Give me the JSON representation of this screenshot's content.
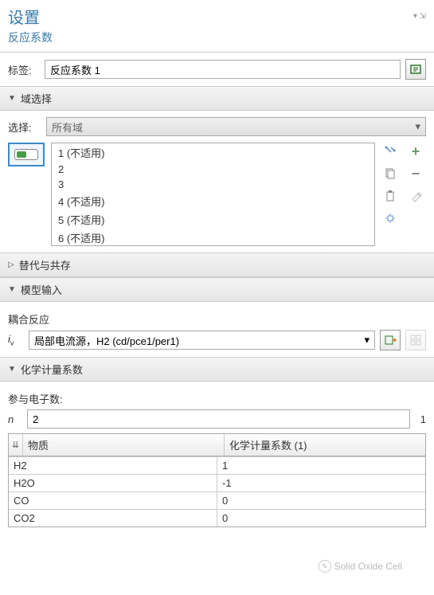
{
  "header": {
    "title": "设置",
    "subtitle": "反应系数"
  },
  "label_row": {
    "label": "标签:",
    "value": "反应系数 1"
  },
  "sections": {
    "domain_sel": "域选择",
    "override": "替代与共存",
    "model_input": "模型输入",
    "stoich": "化学计量系数"
  },
  "selection": {
    "label": "选择:",
    "value": "所有域",
    "items": [
      "1 (不适用)",
      "2",
      "3",
      "4 (不适用)",
      "5 (不适用)",
      "6 (不适用)"
    ]
  },
  "model_input": {
    "coupled_label": "耦合反应",
    "iv_value": "局部电流源，H2 (cd/pce1/per1)"
  },
  "stoich": {
    "electrons_label": "参与电子数:",
    "n_value": "2",
    "unit": "1",
    "col1": "物质",
    "col2": "化学计量系数 (1)",
    "rows": [
      {
        "species": "H2",
        "coef": "1"
      },
      {
        "species": "H2O",
        "coef": "-1"
      },
      {
        "species": "CO",
        "coef": "0"
      },
      {
        "species": "CO2",
        "coef": "0"
      }
    ]
  },
  "watermark": "Solid Oxide Cell"
}
